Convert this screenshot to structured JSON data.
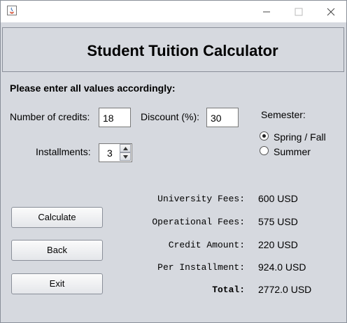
{
  "header": {
    "title": "Student Tuition Calculator"
  },
  "form": {
    "instruction": "Please enter all values accordingly:",
    "credits_label": "Number of credits:",
    "credits_value": "18",
    "discount_label": "Discount (%):",
    "discount_value": "30",
    "semester_label": "Semester:",
    "semester_options": [
      {
        "label": "Spring / Fall",
        "selected": true
      },
      {
        "label": "Summer",
        "selected": false
      }
    ],
    "installments_label": "Installments:",
    "installments_value": "3"
  },
  "buttons": {
    "calculate": "Calculate",
    "back": "Back",
    "exit": "Exit"
  },
  "results": [
    {
      "label": "University Fees:",
      "value": "600 USD"
    },
    {
      "label": "Operational Fees:",
      "value": "575 USD"
    },
    {
      "label": "Credit Amount:",
      "value": "220 USD"
    },
    {
      "label": "Per Installment:",
      "value": "924.0 USD"
    },
    {
      "label": "Total:",
      "value": "2772.0 USD"
    }
  ]
}
